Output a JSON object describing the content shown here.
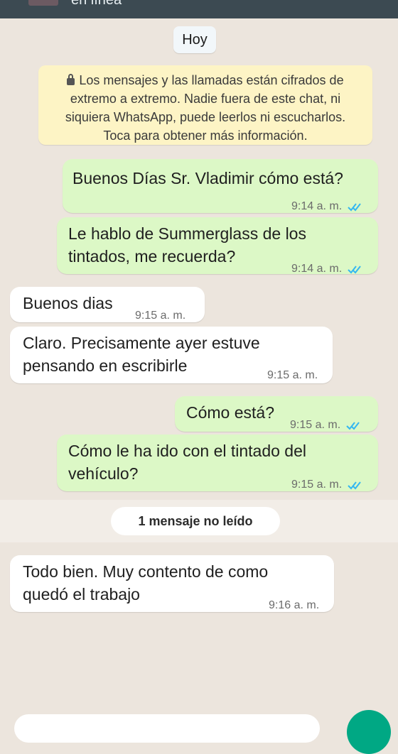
{
  "header": {
    "status": "en línea"
  },
  "date_chip": "Hoy",
  "encryption_notice": {
    "icon": "lock-icon",
    "lines": [
      "Los mensajes y las llamadas están cifrados de",
      "extremo a extremo. Nadie fuera de este chat, ni",
      "siquiera WhatsApp, puede leerlos ni escucharlos.",
      "Toca para obtener más información."
    ]
  },
  "messages": [
    {
      "direction": "out",
      "lines": [
        "Buenos Días Sr. Vladimir cómo está?"
      ],
      "time": "9:14 a. m.",
      "status": "read"
    },
    {
      "direction": "out",
      "lines": [
        "Le hablo de Summerglass de los",
        "tintados, me recuerda?"
      ],
      "time": "9:14 a. m.",
      "status": "read"
    },
    {
      "direction": "in",
      "lines": [
        "Buenos dias"
      ],
      "time": "9:15 a. m."
    },
    {
      "direction": "in",
      "lines": [
        "Claro. Precisamente ayer estuve",
        "pensando en escribirle"
      ],
      "time": "9:15 a. m."
    },
    {
      "direction": "out",
      "lines": [
        "Cómo está?"
      ],
      "time": "9:15 a. m.",
      "status": "read"
    },
    {
      "direction": "out",
      "lines": [
        "Cómo le ha ido con el tintado del",
        "vehículo?"
      ],
      "time": "9:15 a. m.",
      "status": "read"
    },
    {
      "direction": "in",
      "lines": [
        "Todo bien. Muy contento de como",
        "quedó el trabajo"
      ],
      "time": "9:16 a. m."
    }
  ],
  "unread_divider": "1 mensaje no leído",
  "colors": {
    "background": "#ECE5DD",
    "outgoing_bubble": "#DCF8C6",
    "incoming_bubble": "#FFFFFF",
    "notice": "#FDF4C5",
    "read_ticks": "#34B7F1"
  }
}
